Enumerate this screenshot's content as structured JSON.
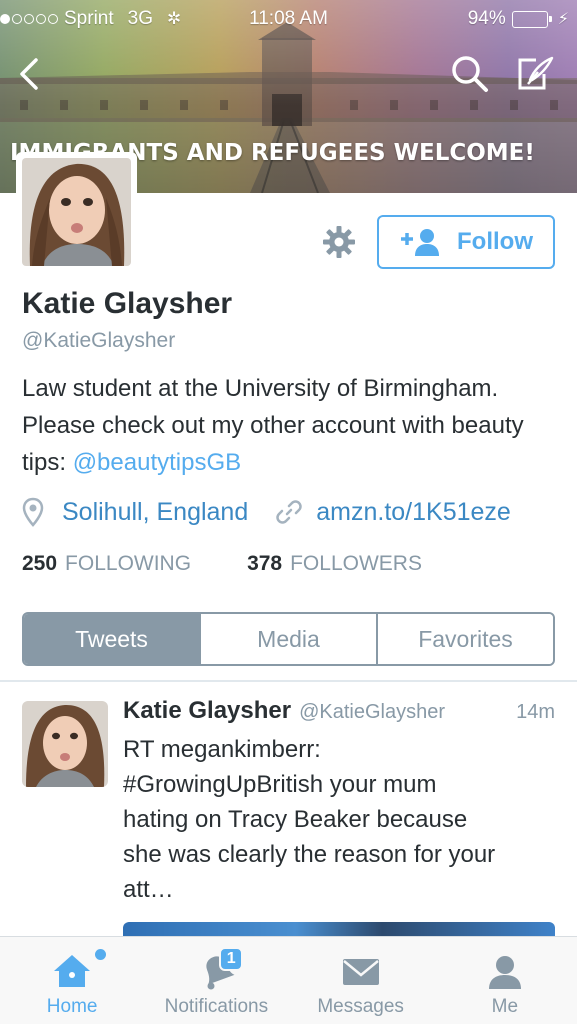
{
  "status_bar": {
    "carrier": "Sprint",
    "network": "3G",
    "time": "11:08 AM",
    "battery": "94%",
    "battery_level": 0.94,
    "signal_bars_filled": 1,
    "signal_bars_total": 5
  },
  "header": {
    "banner_text": "IMMIGRANTS AND REFUGEES WELCOME!",
    "icons": [
      "back-arrow-icon",
      "search-icon",
      "compose-icon"
    ]
  },
  "profile": {
    "name": "Katie Glaysher",
    "handle": "@KatieGlaysher",
    "bio_text": "Law student at the University of Birmingham. Please check out my other account with beauty tips: ",
    "bio_mention": "@beautytipsGB",
    "location": "Solihull, England",
    "website": "amzn.to/1K51eze",
    "following_count": "250",
    "following_label": "FOLLOWING",
    "followers_count": "378",
    "followers_label": "FOLLOWERS",
    "follow_button_label": "Follow"
  },
  "tabs": [
    {
      "label": "Tweets",
      "active": true
    },
    {
      "label": "Media",
      "active": false
    },
    {
      "label": "Favorites",
      "active": false
    }
  ],
  "tweet": {
    "name": "Katie Glaysher",
    "handle": "@KatieGlaysher",
    "time": "14m",
    "text": "RT megankimberr:\n#GrowingUpBritish your mum\nhating on Tracy Beaker because\nshe was clearly the reason for your\natt…"
  },
  "tabbar": {
    "items": [
      {
        "label": "Home",
        "active": true
      },
      {
        "label": "Notifications",
        "active": false,
        "badge": "1"
      },
      {
        "label": "Messages",
        "active": false
      },
      {
        "label": "Me",
        "active": false
      }
    ]
  },
  "colors": {
    "accent": "#55acee",
    "muted": "#8899a6",
    "text": "#292f33",
    "battery": "#4cd964"
  }
}
